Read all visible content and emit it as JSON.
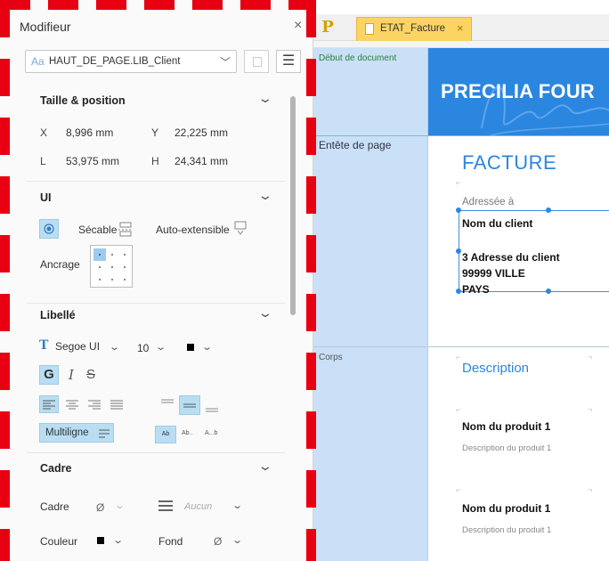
{
  "panel": {
    "title": "Modifieur",
    "close_icon": "×",
    "selector": {
      "prefix": "Aa",
      "value": "HAUT_DE_PAGE.LIB_Client"
    },
    "sections": {
      "taille": {
        "title": "Taille & position",
        "x_label": "X",
        "x_value": "8,996 mm",
        "y_label": "Y",
        "y_value": "22,225 mm",
        "l_label": "L",
        "l_value": "53,975 mm",
        "h_label": "H",
        "h_value": "24,341 mm"
      },
      "ui": {
        "title": "UI",
        "secable": "Sécable",
        "auto_extensible": "Auto-extensible",
        "ancrage": "Ancrage"
      },
      "libelle": {
        "title": "Libellé",
        "font": "Segoe UI",
        "size": "10",
        "bold": "G",
        "italic": "I",
        "strike": "S",
        "multiligne": "Multiligne",
        "case_opts": [
          "Ab",
          "Ab..",
          "A...b"
        ]
      },
      "cadre": {
        "title": "Cadre",
        "cadre_label": "Cadre",
        "cadre_value": "Ø",
        "line_value": "Aucun",
        "couleur_label": "Couleur",
        "fond_label": "Fond",
        "fond_value": "Ø"
      }
    }
  },
  "tabs": {
    "logo": "P",
    "active": "ETAT_Facture",
    "close": "×"
  },
  "bands": {
    "debut": "Début de document",
    "entete": "Entête de page",
    "corps": "Corps"
  },
  "report": {
    "banner_title": "PRECILIA FOUR",
    "facture": "FACTURE",
    "adressee": "Adressée à",
    "client_name": "Nom du client",
    "client_addr1": "3 Adresse du client",
    "client_addr2": "99999 VILLE",
    "client_country": "PAYS",
    "description_head": "Description",
    "products": [
      {
        "name": "Nom du produit 1",
        "desc": "Description du produit 1"
      },
      {
        "name": "Nom du produit 1",
        "desc": "Description du produit 1"
      }
    ]
  },
  "colors": {
    "accent_blue": "#2b86e0",
    "band_blue": "#c9e0f7",
    "tab_yellow": "#fbd464",
    "frame_red": "#e60012"
  }
}
